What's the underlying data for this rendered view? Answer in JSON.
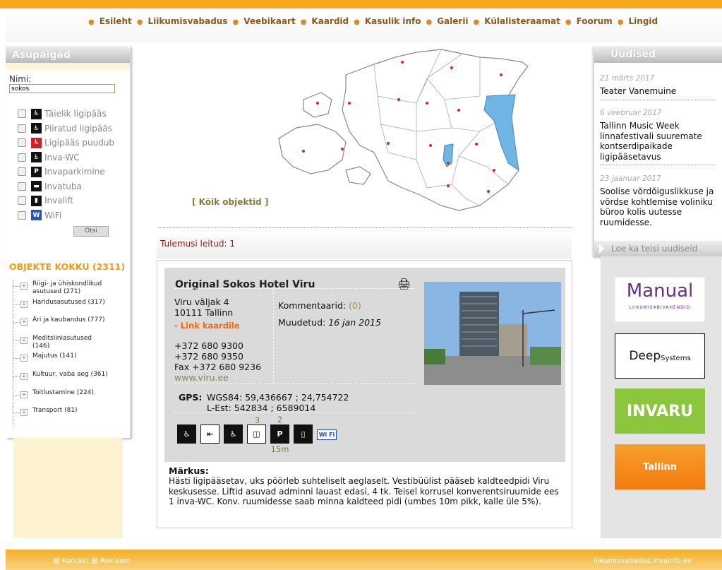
{
  "nav": [
    "Esileht",
    "Liikumisvabadus",
    "Veebikaart",
    "Kaardid",
    "Kasulik info",
    "Galerii",
    "Külalisteraamat",
    "Foorum",
    "Lingid"
  ],
  "left": {
    "title": "Asupaigad",
    "name_label": "Nimi:",
    "name_value": "sokos",
    "filters": [
      "Täielik ligipääs",
      "Piiratud ligipääs",
      "Ligipääs puudub",
      "Inva-WC",
      "Invaparkimine",
      "Invatuba",
      "Invalift",
      "WiFi"
    ],
    "search_button": "Otsi",
    "total": "OBJEKTE KOKKU (2311)",
    "categories": [
      "Riigi- ja ühiskondlikud asutused (271)",
      "Haridusasutused (317)",
      "Äri ja kaubandus (777)",
      "Meditsiiniasutused (146)",
      "Majutus (141)",
      "Kultuur, vaba aeg (361)",
      "Toitlustamine (224)",
      "Transport (81)"
    ]
  },
  "all_objects_link": "[ Kõik objektid ]",
  "results_text": "Tulemusi leitud: 1",
  "card": {
    "title": "Original Sokos Hotel Viru",
    "address1": "Viru väljak 4",
    "address2": "10111 Tallinn",
    "map_link": "- Link kaardile",
    "phone1": "+372 680 9300",
    "phone2": "+372 680 9350",
    "fax": "Fax +372 680 9236",
    "www": "www.viru.ee",
    "comments_label": "Kommentaarid:",
    "comments_count": "(0)",
    "modified_label": "Muudetud:",
    "modified_date": "16 jan 2015",
    "gps_label": "GPS:",
    "gps_wgs": "WGS84: 59,436667 ; 24,754722",
    "gps_lest": "L-Est: 542834 ; 6589014",
    "icon_count_room": "3",
    "icon_count_parking": "2",
    "icon_parking_distance": "15m",
    "wifi_badge": "Wi Fi",
    "note_label": "Märkus:",
    "note": "Hästi ligipääsetav, uks pöörleb suhteliselt aeglaselt. Vestibüülist pääseb kaldteedpidi Viru keskusesse. Liftid asuvad adminni lauast edasi, 4 tk. Teisel korrusel konverentsiruumide ees 1 inva-WC. Konv. ruumidesse saab minna kaldteed pidi (umbes 10m pikk, kalle üle 5%)."
  },
  "news": {
    "title": "Uudised",
    "items": [
      {
        "date": "21 märts 2017",
        "title": "Teater Vanemuine"
      },
      {
        "date": "6 veebruar 2017",
        "title": "Tallinn Music Week linnafestivali suuremate kontserdipaikade ligipääsetavus"
      },
      {
        "date": "23 jaanuar 2017",
        "title": "Soolise võrdõiguslikkuse ja võrdse kohtlemise voliniku büroo kolis uutesse ruumidesse."
      }
    ],
    "more": "Loe ka teisi uudiseid"
  },
  "logos": {
    "manual": "Manual",
    "manual_sub": "LIIKUMISABIVAHENDID",
    "deep": "Deep",
    "deep_sub": "Systems",
    "invaru": "INVARU",
    "tallinn": "Tallinn"
  },
  "footer": {
    "contact": "Kontakt",
    "ads": "Reklaam",
    "site": "liikumisvabadus.invainfo.ee"
  },
  "colors": {
    "accent": "#f6a91e",
    "nav_text": "#8a5a1a",
    "link_orange": "#f06a10",
    "map_water": "#6fb6e6"
  }
}
